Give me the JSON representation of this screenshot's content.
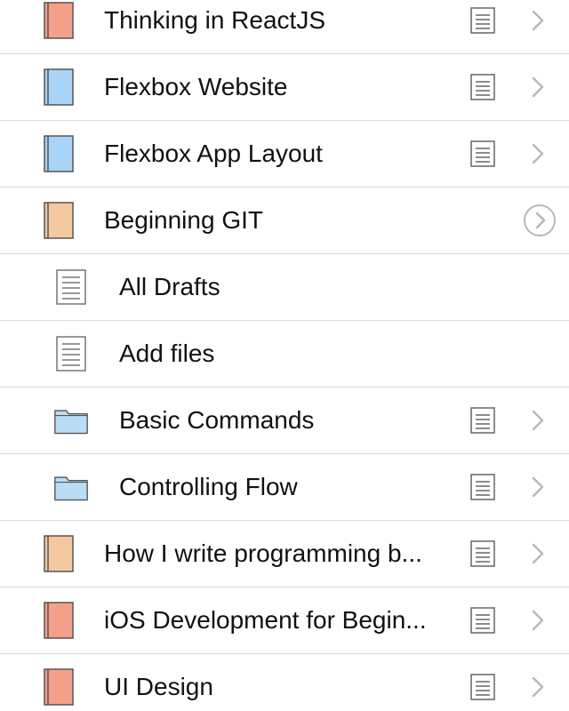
{
  "colors": {
    "book_red": "#f4a08b",
    "book_blue": "#a9d4f5",
    "book_orange": "#f5c9a0",
    "folder_blue": "#b9dcf7",
    "icon_stroke": "#555555",
    "chevron": "#b8b8b8"
  },
  "items": [
    {
      "label": "Thinking in ReactJS",
      "icon": "book-red-icon",
      "accessory": "document-chevron"
    },
    {
      "label": "Flexbox Website",
      "icon": "book-blue-icon",
      "accessory": "document-chevron"
    },
    {
      "label": "Flexbox App Layout",
      "icon": "book-blue-icon",
      "accessory": "document-chevron"
    },
    {
      "label": "Beginning GIT",
      "icon": "book-orange-icon",
      "accessory": "circle-chevron"
    },
    {
      "label": "All Drafts",
      "icon": "document-icon",
      "accessory": "none"
    },
    {
      "label": "Add files",
      "icon": "document-icon",
      "accessory": "none"
    },
    {
      "label": "Basic Commands",
      "icon": "folder-icon",
      "accessory": "document-chevron"
    },
    {
      "label": "Controlling Flow",
      "icon": "folder-icon",
      "accessory": "document-chevron"
    },
    {
      "label": "How I write programming b...",
      "icon": "book-orange-icon",
      "accessory": "document-chevron"
    },
    {
      "label": "iOS Development for Begin...",
      "icon": "book-red-icon",
      "accessory": "document-chevron"
    },
    {
      "label": "UI Design",
      "icon": "book-red-icon",
      "accessory": "document-chevron"
    }
  ]
}
